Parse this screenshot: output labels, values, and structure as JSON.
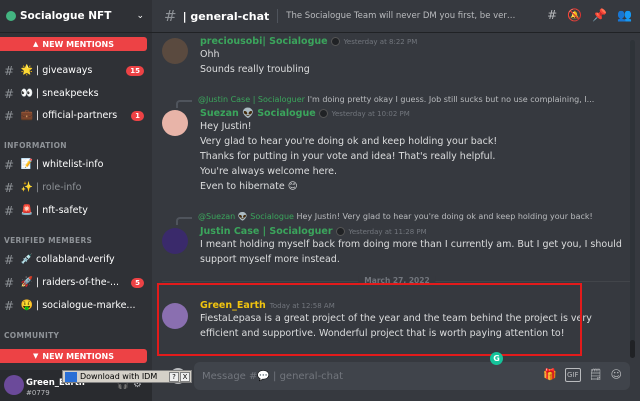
{
  "server": {
    "name": "Socialogue NFT"
  },
  "sidebar": {
    "new_mentions_label": "NEW MENTIONS",
    "categories": {
      "information": "INFORMATION",
      "verified": "VERIFIED MEMBERS",
      "community": "COMMUNITY"
    },
    "channels": [
      {
        "emoji": "🌟",
        "label": "| giveaways",
        "badge": "15"
      },
      {
        "emoji": "👀",
        "label": "| sneakpeeks"
      },
      {
        "emoji": "💼",
        "label": "| official-partners",
        "badge": "1"
      },
      {
        "emoji": "📝",
        "label": "| whitelist-info"
      },
      {
        "emoji": "✨",
        "label": "| role-info"
      },
      {
        "emoji": "🚨",
        "label": "| nft-safety"
      },
      {
        "emoji": "💉",
        "label": "collabland-verify"
      },
      {
        "emoji": "🚀",
        "label": "| raiders-of-the-...",
        "badge": "5"
      },
      {
        "emoji": "🤑",
        "label": "| socialogue-marke..."
      }
    ]
  },
  "user": {
    "name": "Green_Earth",
    "tag": "#0779"
  },
  "idm": {
    "label": "Download with IDM",
    "help": "?",
    "close": "X"
  },
  "topbar": {
    "channel_name": "| general-chat",
    "topic": "The Socialogue Team will never DM you first, be very careful."
  },
  "messages": [
    {
      "author": "preciousobi| Socialogue",
      "author_color": "#3ba55c",
      "timestamp": "Yesterday at 8:22 PM",
      "lines": [
        "Ohh",
        "Sounds really troubling"
      ]
    },
    {
      "reply_author": "@Justin Case | Socialoguer",
      "reply_text": "I'm doing pretty okay I guess. Job still sucks but no use complaining, I...",
      "author": "Suezan 👽 Socialogue",
      "author_color": "#3ba55c",
      "timestamp": "Yesterday at 10:02 PM",
      "lines": [
        "Hey Justin!",
        "Very glad to hear you're doing ok and keep holding your back!",
        "Thanks for putting in your vote and idea! That's really helpful.",
        "You're always welcome here.",
        "Even to hibernate 😊"
      ]
    },
    {
      "reply_author": "@Suezan 👽 Socialogue",
      "reply_text": "Hey Justin! Very glad to hear you're doing ok and keep holding your back!",
      "author": "Justin Case | Socialoguer",
      "author_color": "#3ba55c",
      "timestamp": "Yesterday at 11:28 PM",
      "lines": [
        "I meant holding myself back from doing more than I currently am. But I get you, I should",
        "support myself more instead."
      ]
    },
    {
      "author": "Green_Earth",
      "author_color": "#f1c40f",
      "timestamp": "Today at 12:58 AM",
      "lines": [
        "FiestaLepasa is a great project of the year and the team behind the project is very",
        "efficient and supportive. Wonderful project that is worth paying attention to!"
      ]
    }
  ],
  "date_divider": "March 27, 2022",
  "composer": {
    "placeholder": "Message #💬 | general-chat",
    "grammarly": "G",
    "gif": "GIF"
  }
}
